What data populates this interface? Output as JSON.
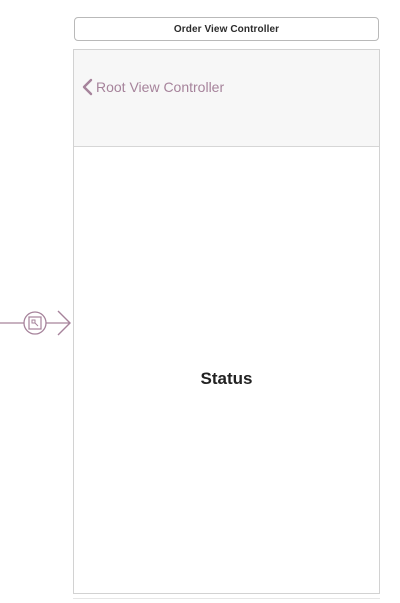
{
  "scene": {
    "title": "Order View Controller"
  },
  "nav_bar": {
    "back_label": "Root View Controller"
  },
  "content": {
    "status_label": "Status"
  },
  "icons": {
    "back": "chevron-left-icon",
    "segue": "segue-connector-icon"
  },
  "colors": {
    "accent": "#a6839b",
    "nav_background": "#f7f7f7",
    "label_text": "#222222"
  }
}
